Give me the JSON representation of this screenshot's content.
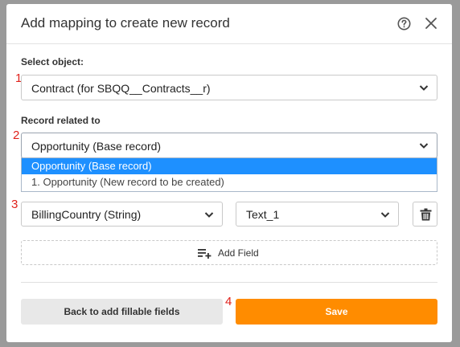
{
  "dialog": {
    "title": "Add mapping to create new record"
  },
  "icons": {
    "help": "help-circle-icon",
    "close": "close-icon",
    "chevron": "chevron-down-icon",
    "trash": "trash-icon",
    "add_field": "playlist-add-icon"
  },
  "markers": [
    "1",
    "2",
    "3",
    "4"
  ],
  "select_object": {
    "label": "Select object:",
    "value": "Contract (for SBQQ__Contracts__r)"
  },
  "record_related": {
    "label": "Record related to",
    "value": "Opportunity (Base record)",
    "options": [
      "Opportunity (Base record)",
      "1. Opportunity (New record to be created)"
    ],
    "selected_index": 0
  },
  "mapping": {
    "source_field": "BillingCountry (String)",
    "target_field": "Text_1"
  },
  "add_field_label": "Add Field",
  "buttons": {
    "back": "Back to add fillable fields",
    "save": "Save"
  },
  "colors": {
    "accent": "#ff8c00",
    "selected_option": "#1e90ff",
    "marker": "#e0211b"
  }
}
